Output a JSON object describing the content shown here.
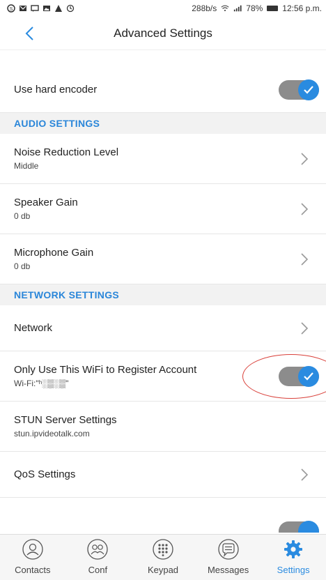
{
  "status_bar": {
    "icons": [
      "skype-icon",
      "gmail-icon",
      "message-icon",
      "gallery-icon",
      "warning-icon",
      "sync-icon"
    ],
    "speed": "288b/s",
    "battery": "78%",
    "time": "12:56 p.m."
  },
  "header": {
    "title": "Advanced Settings"
  },
  "rows": {
    "hard_encoder": {
      "label": "Use hard encoder",
      "toggle": true
    },
    "audio_section": "AUDIO SETTINGS",
    "noise": {
      "label": "Noise Reduction Level",
      "value": "Middle"
    },
    "speaker": {
      "label": "Speaker Gain",
      "value": "0 db"
    },
    "mic": {
      "label": "Microphone Gain",
      "value": "0 db"
    },
    "network_section": "NETWORK SETTINGS",
    "network": {
      "label": "Network"
    },
    "wifi_only": {
      "label": "Only Use This WiFi to Register Account",
      "value": "Wi-Fi:\"ʰ░▒░▒\"",
      "toggle": true
    },
    "stun": {
      "label": "STUN Server Settings",
      "value": "stun.ipvideotalk.com"
    },
    "qos": {
      "label": "QoS Settings"
    }
  },
  "tabs": [
    {
      "label": "Contacts",
      "icon": "contacts-icon",
      "active": false
    },
    {
      "label": "Conf",
      "icon": "conference-icon",
      "active": false
    },
    {
      "label": "Keypad",
      "icon": "keypad-icon",
      "active": false
    },
    {
      "label": "Messages",
      "icon": "messages-icon",
      "active": false
    },
    {
      "label": "Settings",
      "icon": "settings-gear-icon",
      "active": true
    }
  ],
  "colors": {
    "accent": "#2a8be0",
    "section_text": "#2a86d9",
    "annotation": "#d9403a"
  }
}
